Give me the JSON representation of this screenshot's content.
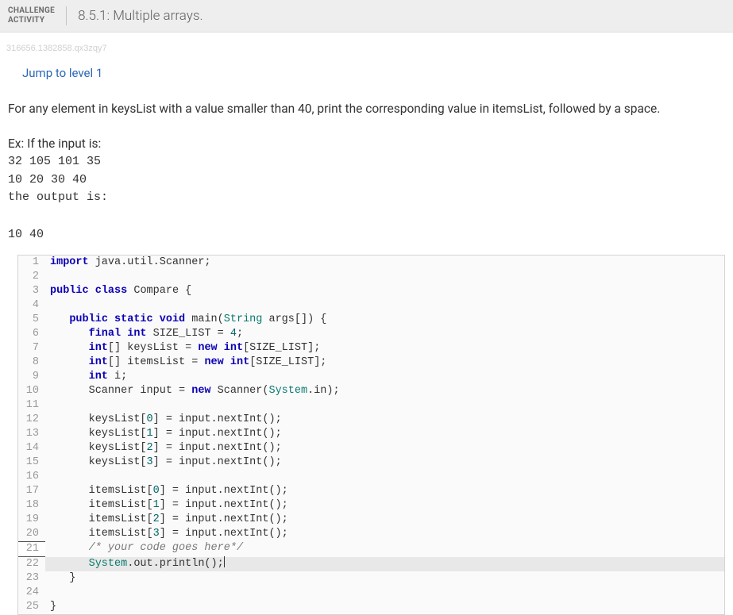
{
  "header": {
    "label_line1": "CHALLENGE",
    "label_line2": "ACTIVITY",
    "title": "8.5.1: Multiple arrays."
  },
  "id_string": "316656.1382858.qx3zqy7",
  "jump_link": "Jump to level 1",
  "problem": {
    "statement": "For any element in keysList with a value smaller than 40, print the corresponding value in itemsList, followed by a space.",
    "ex_label": "Ex: If the input is:",
    "input_block": "32 105 101 35\n10 20 30 40",
    "output_label": "the output is:",
    "output_block": "10 40"
  },
  "code": {
    "lines": [
      {
        "n": 1,
        "t": "<span class=\"tok-kw\">import</span> java.util.Scanner;"
      },
      {
        "n": 2,
        "t": ""
      },
      {
        "n": 3,
        "t": "<span class=\"tok-kw\">public</span> <span class=\"tok-kw\">class</span> <span class=\"tok-cls\">Compare</span> {"
      },
      {
        "n": 4,
        "t": ""
      },
      {
        "n": 5,
        "t": "   <span class=\"tok-kw\">public</span> <span class=\"tok-kw\">static</span> <span class=\"tok-kw\">void</span> main(<span class=\"tok-type\">String</span> args[]) {"
      },
      {
        "n": 6,
        "t": "      <span class=\"tok-kw\">final</span> <span class=\"tok-kw\">int</span> SIZE_LIST = <span class=\"tok-num\">4</span>;"
      },
      {
        "n": 7,
        "t": "      <span class=\"tok-kw\">int</span>[] keysList = <span class=\"tok-kw\">new</span> <span class=\"tok-kw\">int</span>[SIZE_LIST];"
      },
      {
        "n": 8,
        "t": "      <span class=\"tok-kw\">int</span>[] itemsList = <span class=\"tok-kw\">new</span> <span class=\"tok-kw\">int</span>[SIZE_LIST];"
      },
      {
        "n": 9,
        "t": "      <span class=\"tok-kw\">int</span> i;"
      },
      {
        "n": 10,
        "t": "      Scanner input = <span class=\"tok-kw\">new</span> Scanner(<span class=\"tok-type\">System</span>.in);"
      },
      {
        "n": 11,
        "t": ""
      },
      {
        "n": 12,
        "t": "      keysList[<span class=\"tok-num\">0</span>] = input.nextInt();"
      },
      {
        "n": 13,
        "t": "      keysList[<span class=\"tok-num\">1</span>] = input.nextInt();"
      },
      {
        "n": 14,
        "t": "      keysList[<span class=\"tok-num\">2</span>] = input.nextInt();"
      },
      {
        "n": 15,
        "t": "      keysList[<span class=\"tok-num\">3</span>] = input.nextInt();"
      },
      {
        "n": 16,
        "t": ""
      },
      {
        "n": 17,
        "t": "      itemsList[<span class=\"tok-num\">0</span>] = input.nextInt();"
      },
      {
        "n": 18,
        "t": "      itemsList[<span class=\"tok-num\">1</span>] = input.nextInt();"
      },
      {
        "n": 19,
        "t": "      itemsList[<span class=\"tok-num\">2</span>] = input.nextInt();"
      },
      {
        "n": 20,
        "t": "      itemsList[<span class=\"tok-num\">3</span>] = input.nextInt();"
      },
      {
        "n": 21,
        "t": "      <span class=\"tok-cm\">/* your code goes here*/</span>",
        "active": true
      },
      {
        "n": 22,
        "t": "      <span class=\"tok-type\">System</span>.out.println();<span class=\"cursor\"></span>",
        "hl": true
      },
      {
        "n": 23,
        "t": "   }"
      },
      {
        "n": 24,
        "t": ""
      },
      {
        "n": 25,
        "t": "}"
      }
    ]
  }
}
